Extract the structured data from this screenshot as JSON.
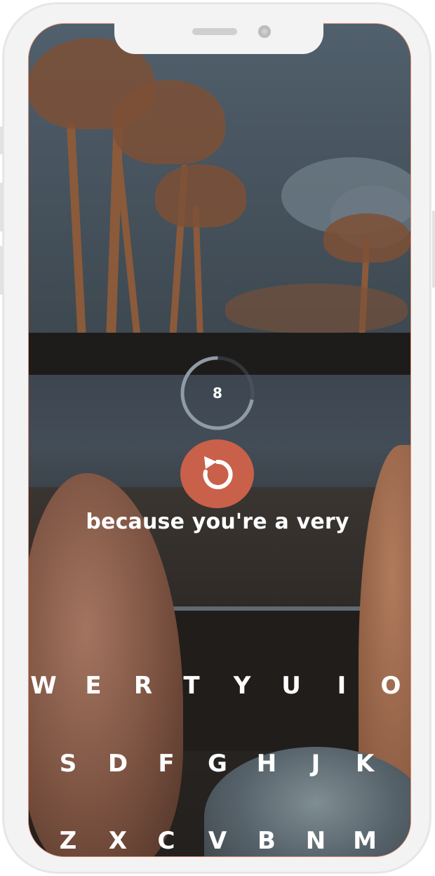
{
  "game": {
    "timer_value": "8",
    "timer_progress": 0.72,
    "phrase": "because you're a very",
    "restart_icon": "restart-icon",
    "accent_color": "#c9604a"
  },
  "keyboard": {
    "row1": [
      "W",
      "E",
      "R",
      "T",
      "Y",
      "U",
      "I",
      "O"
    ],
    "row2": [
      "S",
      "D",
      "F",
      "G",
      "H",
      "J",
      "K"
    ],
    "row3": [
      "Z",
      "X",
      "C",
      "V",
      "B",
      "N",
      "M"
    ]
  }
}
